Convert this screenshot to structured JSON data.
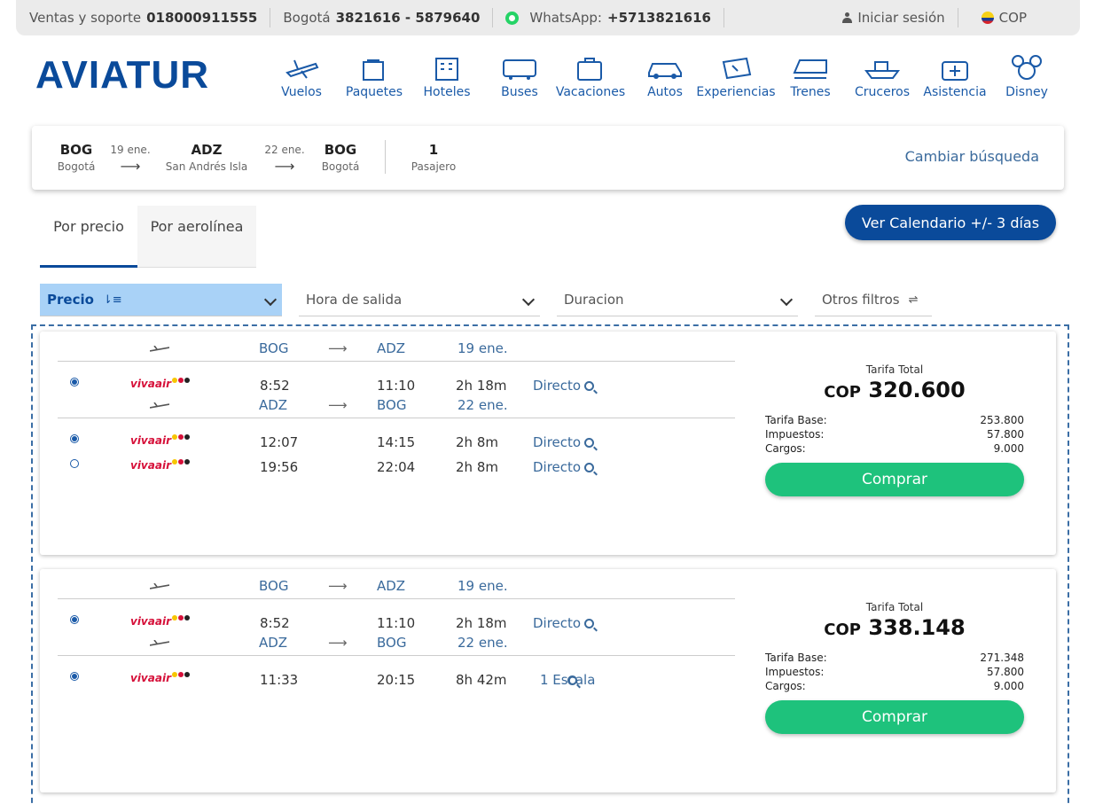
{
  "topbar": {
    "sales_label": "Ventas y soporte",
    "sales_phone": "018000911555",
    "bogota_label": "Bogotá",
    "bogota_phones": "3821616 - 5879640",
    "whatsapp_label": "WhatsApp:",
    "whatsapp_phone": "+5713821616",
    "login": "Iniciar sesión",
    "currency": "COP"
  },
  "header": {
    "logo": "AVIATUR",
    "nav": [
      {
        "label": "Vuelos",
        "icon": "plane-icon"
      },
      {
        "label": "Paquetes",
        "icon": "package-icon"
      },
      {
        "label": "Hoteles",
        "icon": "hotel-icon"
      },
      {
        "label": "Buses",
        "icon": "bus-icon"
      },
      {
        "label": "Vacaciones",
        "icon": "suitcase-icon"
      },
      {
        "label": "Autos",
        "icon": "car-icon"
      },
      {
        "label": "Experiencias",
        "icon": "ticket-icon"
      },
      {
        "label": "Trenes",
        "icon": "train-icon"
      },
      {
        "label": "Cruceros",
        "icon": "ship-icon"
      },
      {
        "label": "Asistencia",
        "icon": "first-aid-icon"
      },
      {
        "label": "Disney",
        "icon": "mickey-icon"
      }
    ]
  },
  "summary": {
    "origin_code": "BOG",
    "origin_city": "Bogotá",
    "outbound_date": "19 ene.",
    "dest_code": "ADZ",
    "dest_city": "San Andrés Isla",
    "return_date": "22 ene.",
    "return_code": "BOG",
    "return_city": "Bogotá",
    "passengers": "1",
    "passengers_label": "Pasajero",
    "change_search": "Cambiar búsqueda"
  },
  "tabs": {
    "by_price": "Por precio",
    "by_airline": "Por aerolínea",
    "calendar_button": "Ver Calendario +/- 3 días"
  },
  "filters": {
    "price": "Precio",
    "departure": "Hora de salida",
    "duration": "Duracion",
    "others": "Otros filtros"
  },
  "results": [
    {
      "outbound": {
        "from": "BOG",
        "to": "ADZ",
        "date": "19 ene.",
        "flights": [
          {
            "airline": "vivaair",
            "dep": "8:52",
            "arr": "11:10",
            "dur": "2h 18m",
            "stops": "Directo",
            "selected": true
          }
        ]
      },
      "inbound": {
        "from": "ADZ",
        "to": "BOG",
        "date": "22 ene.",
        "flights": [
          {
            "airline": "vivaair",
            "dep": "12:07",
            "arr": "14:15",
            "dur": "2h 8m",
            "stops": "Directo",
            "selected": true
          },
          {
            "airline": "vivaair",
            "dep": "19:56",
            "arr": "22:04",
            "dur": "2h 8m",
            "stops": "Directo",
            "selected": false
          }
        ]
      },
      "total_label": "Tarifa Total",
      "currency": "COP",
      "total": "320.600",
      "base_label": "Tarifa Base:",
      "base": "253.800",
      "tax_label": "Impuestos:",
      "tax": "57.800",
      "fees_label": "Cargos:",
      "fees": "9.000",
      "buy": "Comprar"
    },
    {
      "outbound": {
        "from": "BOG",
        "to": "ADZ",
        "date": "19 ene.",
        "flights": [
          {
            "airline": "vivaair",
            "dep": "8:52",
            "arr": "11:10",
            "dur": "2h 18m",
            "stops": "Directo",
            "selected": true
          }
        ]
      },
      "inbound": {
        "from": "ADZ",
        "to": "BOG",
        "date": "22 ene.",
        "flights": [
          {
            "airline": "vivaair",
            "dep": "11:33",
            "arr": "20:15",
            "dur": "8h 42m",
            "stops": "1 Escala",
            "selected": true
          }
        ]
      },
      "total_label": "Tarifa Total",
      "currency": "COP",
      "total": "338.148",
      "base_label": "Tarifa Base:",
      "base": "271.348",
      "tax_label": "Impuestos:",
      "tax": "57.800",
      "fees_label": "Cargos:",
      "fees": "9.000",
      "buy": "Comprar"
    }
  ],
  "colors": {
    "brand": "#0a4a9a",
    "buy": "#1ec27c",
    "link": "#3a6a9c",
    "filter_active": "#a9d2f7"
  }
}
